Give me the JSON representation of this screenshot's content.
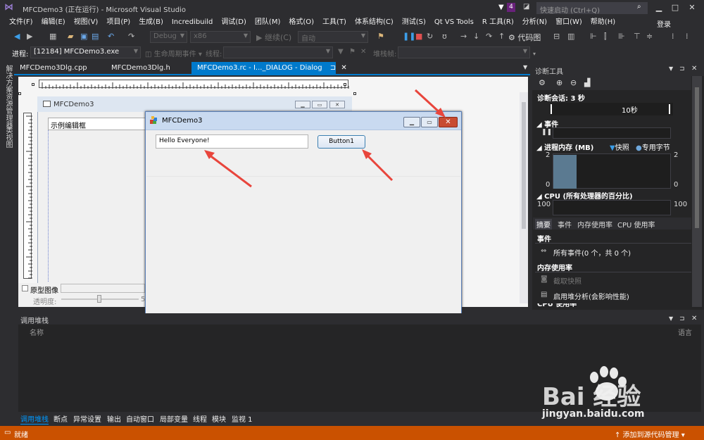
{
  "window": {
    "title": "MFCDemo3 (正在运行) - Microsoft Visual Studio",
    "notification_count": "4",
    "quick_launch_placeholder": "快速启动 (Ctrl+Q)",
    "min": "▁",
    "max": "□",
    "close": "✕"
  },
  "menu": {
    "items": [
      "文件(F)",
      "编辑(E)",
      "视图(V)",
      "项目(P)",
      "生成(B)",
      "Incredibuild",
      "调试(D)",
      "团队(M)",
      "格式(O)",
      "工具(T)",
      "体系结构(C)",
      "测试(S)",
      "Qt VS Tools",
      "R 工具(R)",
      "分析(N)",
      "窗口(W)",
      "帮助(H)"
    ],
    "login": "登录"
  },
  "toolbar": {
    "config": "Debug",
    "platform": "x86",
    "continue": "▶ 继续(C)",
    "auto": "自动",
    "codemap": "代码图"
  },
  "debugbar": {
    "process_label": "进程:",
    "process_value": "[12184] MFCDemo3.exe",
    "lifecycle": "生命周期事件",
    "thread_label": "线程:",
    "stackframe_label": "堆栈帧:"
  },
  "sidebar": {
    "items": [
      "解决方案资源管理器",
      "类视图"
    ]
  },
  "doctabs": {
    "tab1": "MFCDemo3Dlg.cpp",
    "tab2": "MFCDemo3Dlg.h",
    "tab3": "MFCDemo3.rc - I..._DIALOG - Dialog",
    "tab3_pin": "⊐",
    "tab3_close": "✕"
  },
  "design_dialog": {
    "title": "MFCDemo3",
    "edit_text": "示例编辑框"
  },
  "proto": {
    "label": "原型图像",
    "opacity_label": "透明度:",
    "opacity_value_suffix": "5"
  },
  "running_dialog": {
    "title": "MFCDemo3",
    "edit_value": "Hello Everyone!",
    "button_label": "Button1"
  },
  "diagnostics": {
    "title": "诊断工具",
    "session": "诊断会话: 3 秒",
    "timeline_label": "10秒",
    "events_header": "事件",
    "memory_header": "进程内存 (MB)",
    "legend_snapshot": "快照",
    "legend_private": "专用字节",
    "mem_max": "2",
    "mem_min": "0",
    "cpu_header": "CPU (所有处理器的百分比)",
    "cpu_max": "100",
    "tabs": [
      "摘要",
      "事件",
      "内存使用率",
      "CPU 使用率"
    ],
    "summary_events_header": "事件",
    "all_events": "所有事件(0 个，共 0 个)",
    "memory_usage_header": "内存使用率",
    "take_snapshot": "截取快照",
    "heap_profiling": "启用堆分析(会影响性能)",
    "cpu_usage_partial": "CPU 使用率"
  },
  "callstack": {
    "title": "调用堆栈",
    "col_name": "名称",
    "col_lang": "语言"
  },
  "bottom_tabs": [
    "调用堆栈",
    "断点",
    "异常设置",
    "输出",
    "自动窗口",
    "局部变量",
    "线程",
    "模块",
    "监视 1"
  ],
  "status": {
    "text": "就绪",
    "right": "↑ 添加到源代码管理 ▾"
  },
  "watermark": {
    "text": "Bai 经验",
    "url": "jingyan.baidu.com"
  },
  "colors": {
    "accent": "#007acc",
    "status_bar": "#ca5100",
    "annotation_arrow": "#e8453c"
  }
}
